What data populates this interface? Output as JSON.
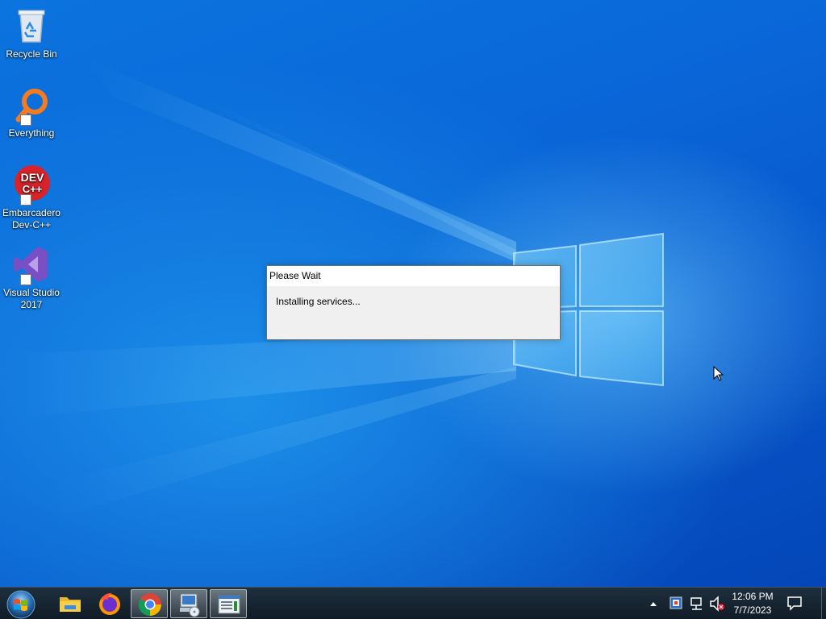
{
  "desktop": {
    "icons": [
      {
        "label": "Recycle Bin"
      },
      {
        "label": "Everything"
      },
      {
        "label": "Embarcadero Dev-C++",
        "logo_text": "DEV C++"
      },
      {
        "label": "Visual Studio 2017"
      }
    ]
  },
  "dialog": {
    "title": "Please Wait",
    "message": "Installing services..."
  },
  "taskbar": {
    "apps": [
      {
        "icon": "folder-icon",
        "name": "File Explorer"
      },
      {
        "icon": "firefox-icon",
        "name": "Firefox"
      },
      {
        "icon": "chrome-icon",
        "name": "Google Chrome"
      },
      {
        "icon": "installer-icon",
        "name": "Installer",
        "active": true
      },
      {
        "icon": "window-icon",
        "name": "Window"
      }
    ],
    "tray_icons": [
      "chevron-up-icon",
      "tray-app-icon",
      "network-icon",
      "volume-muted-icon",
      "notification-icon"
    ],
    "clock": {
      "time": "12:06 PM",
      "date": "7/7/2023"
    }
  },
  "colors": {
    "wallpaper": "#0a67d8",
    "taskbar": "#152330",
    "dialog_bg": "#f0f0f0"
  }
}
